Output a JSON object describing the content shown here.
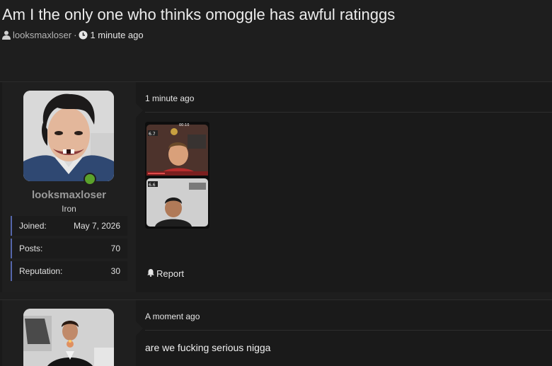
{
  "thread": {
    "title": "Am I the only one who thinks omoggle has awful ratinggs",
    "author": "looksmaxloser",
    "separator": "·",
    "time": "1 minute ago"
  },
  "posts": [
    {
      "username": "looksmaxloser",
      "rank": "Iron",
      "stats": [
        {
          "label": "Joined:",
          "value": "May 7, 2026"
        },
        {
          "label": "Posts:",
          "value": "70"
        },
        {
          "label": "Reputation:",
          "value": "30"
        }
      ],
      "time": "1 minute ago",
      "report_label": "Report",
      "online": true,
      "attachment": {
        "top_score": "6.7",
        "bottom_score": "6.6",
        "clock": "00:10"
      }
    },
    {
      "time": "A moment ago",
      "text": "are we fucking serious nigga"
    }
  ],
  "colors": {
    "background": "#1e1e1e",
    "stat_accent": "#5566aa",
    "online": "#5ba22b"
  },
  "icons": [
    "user-icon",
    "clock-icon",
    "bell-icon"
  ]
}
